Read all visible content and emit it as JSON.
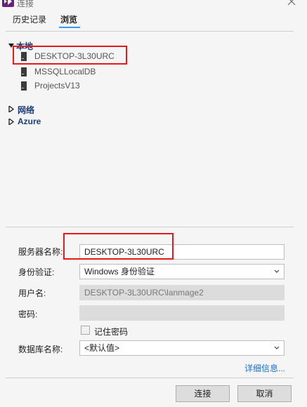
{
  "window": {
    "title": "连接"
  },
  "tabs": [
    {
      "label": "历史记录",
      "active": false
    },
    {
      "label": "浏览",
      "active": true
    }
  ],
  "tree": {
    "local": {
      "label": "本地",
      "expanded": true,
      "servers": [
        "DESKTOP-3L30URC",
        "MSSQLLocalDB",
        "ProjectsV13"
      ]
    },
    "network": {
      "label": "网络",
      "expanded": false
    },
    "azure": {
      "label": "Azure",
      "expanded": false
    }
  },
  "form": {
    "server_name": {
      "label": "服务器名称:",
      "value": "DESKTOP-3L30URC"
    },
    "authentication": {
      "label": "身份验证:",
      "value": "Windows 身份验证"
    },
    "username": {
      "label": "用户名:",
      "value": "DESKTOP-3L30URC\\lanmage2"
    },
    "password": {
      "label": "密码:",
      "value": ""
    },
    "remember_password": {
      "label": "记住密码",
      "checked": false
    },
    "database": {
      "label": "数据库名称:",
      "value": "<默认值>"
    }
  },
  "details_link": "详细信息...",
  "buttons": {
    "connect": "连接",
    "cancel": "取消"
  },
  "colors": {
    "highlight_border": "#e81919",
    "link": "#1a6fd1",
    "tab_underline": "#3399ff",
    "group_text": "#1a3d7c"
  }
}
